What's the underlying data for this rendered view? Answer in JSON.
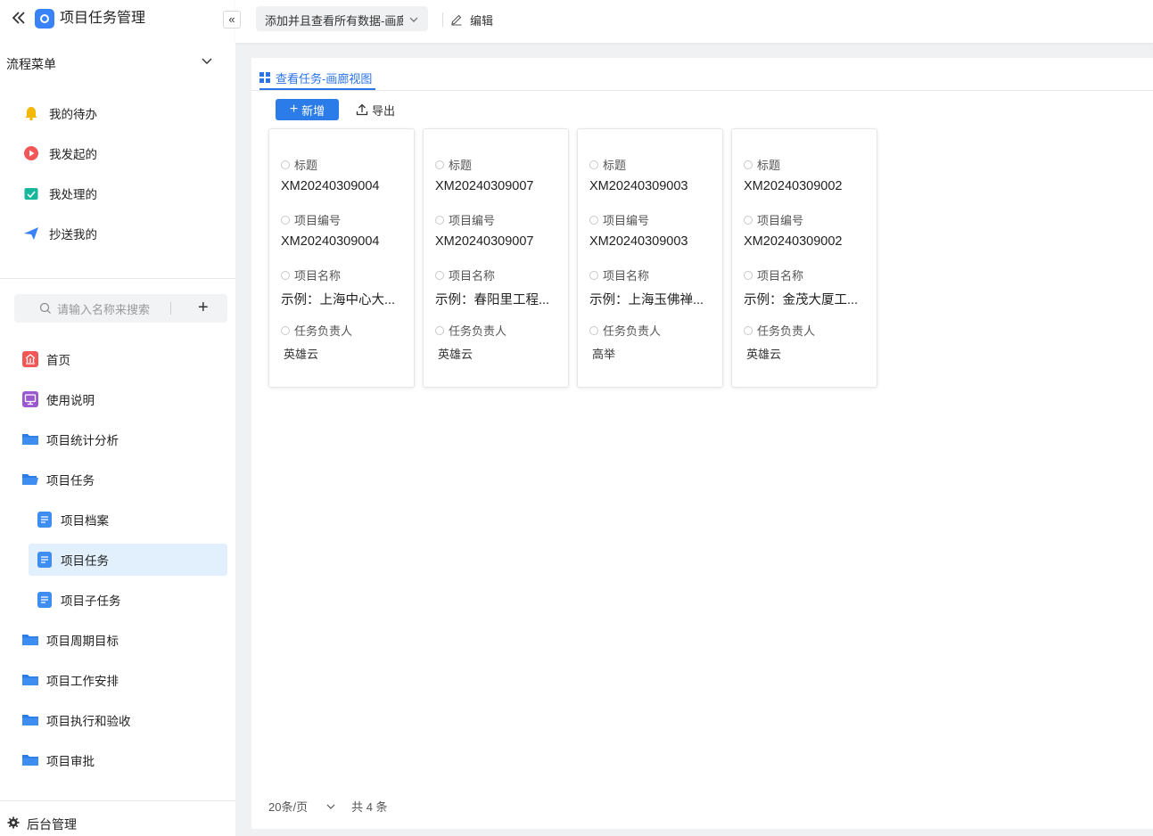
{
  "app": {
    "title": "项目任务管理"
  },
  "flow_menu": {
    "label": "流程菜单",
    "items": [
      {
        "label": "我的待办",
        "icon": "bell-icon"
      },
      {
        "label": "我发起的",
        "icon": "play-circle-icon"
      },
      {
        "label": "我处理的",
        "icon": "check-box-icon"
      },
      {
        "label": "抄送我的",
        "icon": "send-icon"
      }
    ]
  },
  "search": {
    "placeholder": "请输入名称来搜索",
    "add": "+"
  },
  "nav": {
    "items": [
      {
        "label": "首页"
      },
      {
        "label": "使用说明"
      },
      {
        "label": "项目统计分析"
      },
      {
        "label": "项目任务"
      },
      {
        "label": "项目档案"
      },
      {
        "label": "项目任务"
      },
      {
        "label": "项目子任务"
      },
      {
        "label": "项目周期目标"
      },
      {
        "label": "项目工作安排"
      },
      {
        "label": "项目执行和验收"
      },
      {
        "label": "项目审批"
      }
    ]
  },
  "admin": {
    "label": "后台管理"
  },
  "topbar": {
    "view_select": "添加并且查看所有数据-画廊视图",
    "edit": "编辑",
    "collapse": "«"
  },
  "main": {
    "tab": "查看任务-画廊视图",
    "add_button": "新增",
    "export_button": "导出",
    "field_labels": {
      "title": "标题",
      "code": "项目编号",
      "name": "项目名称",
      "owner": "任务负责人"
    },
    "cards": [
      {
        "title": "XM20240309004",
        "code": "XM20240309004",
        "name": "示例：上海中心大...",
        "owner": "英雄云"
      },
      {
        "title": "XM20240309007",
        "code": "XM20240309007",
        "name": "示例：春阳里工程...",
        "owner": "英雄云"
      },
      {
        "title": "XM20240309003",
        "code": "XM20240309003",
        "name": "示例：上海玉佛禅...",
        "owner": "高举"
      },
      {
        "title": "XM20240309002",
        "code": "XM20240309002",
        "name": "示例：金茂大厦工...",
        "owner": "英雄云"
      }
    ],
    "pager": {
      "page_size": "20条/页",
      "total": "共 4 条"
    }
  },
  "colors": {
    "accent": "#2b7be9",
    "active_bg": "#e1f0fc",
    "folder": "#2b7be9"
  }
}
